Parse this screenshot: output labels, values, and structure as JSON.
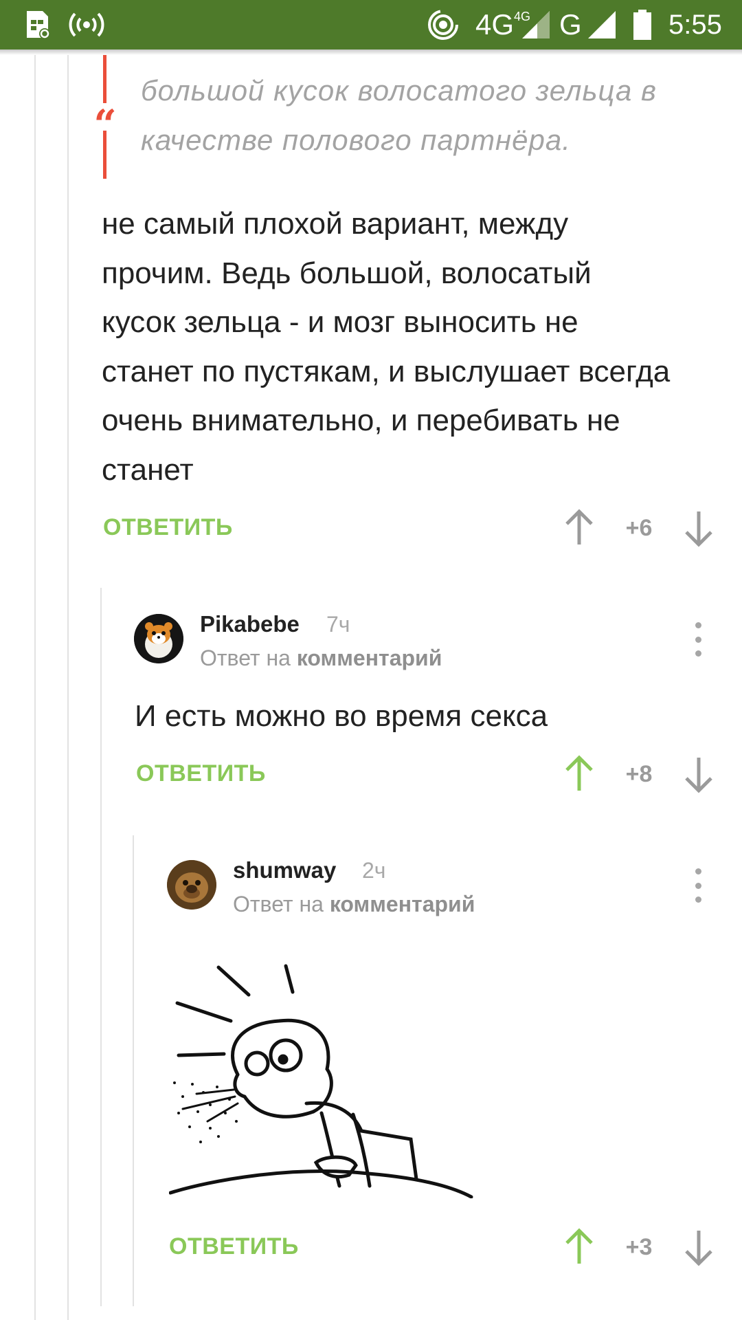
{
  "status_bar": {
    "network_1": "4G",
    "network_1_sup": "4G",
    "network_2": "G",
    "time": "5:55"
  },
  "quote": {
    "mark": "“",
    "text": "большой кусок волосатого зельца в качестве полового партнёра."
  },
  "comments": [
    {
      "text": "не самый плохой вариант, между прочим. Ведь большой, волосатый кусок зельца - и мозг выносить не станет по пустякам, и выслушает всегда очень внимательно, и перебивать не станет",
      "reply_label": "ОТВЕТИТЬ",
      "score": "+6",
      "upvoted": false
    },
    {
      "author": "Pikabebe",
      "time": "7ч",
      "reply_to_prefix": "Ответ на",
      "reply_to_link": "комментарий",
      "text": "И есть можно во время секса",
      "reply_label": "ОТВЕТИТЬ",
      "score": "+8",
      "upvoted": true
    },
    {
      "author": "shumway",
      "time": "2ч",
      "reply_to_prefix": "Ответ на",
      "reply_to_link": "комментарий",
      "image": "cereal-guy-spitting-meme",
      "reply_label": "ОТВЕТИТЬ",
      "score": "+3",
      "upvoted": true
    }
  ],
  "colors": {
    "status_bar": "#4e7a2a",
    "accent_green": "#8ac858",
    "quote_red": "#ea4e3a",
    "muted": "#9a9a9a"
  }
}
